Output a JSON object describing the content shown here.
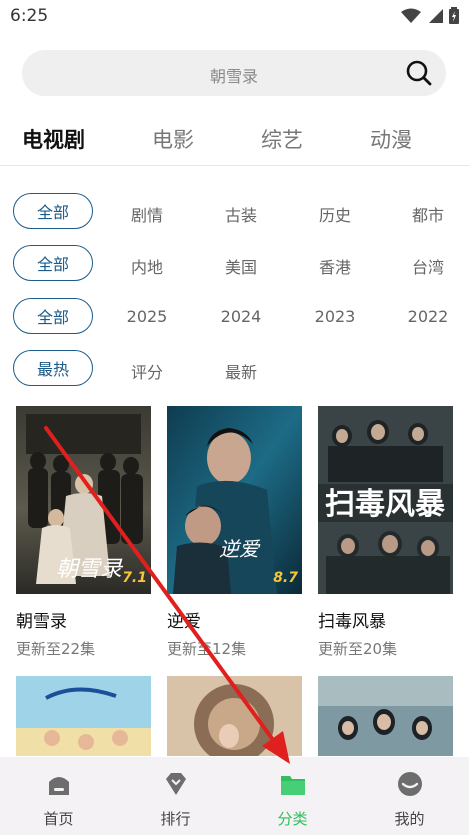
{
  "status_bar": {
    "time": "6:25"
  },
  "search": {
    "placeholder": "朝雪录"
  },
  "category_tabs": [
    {
      "label": "电视剧",
      "active": true
    },
    {
      "label": "电影"
    },
    {
      "label": "综艺"
    },
    {
      "label": "动漫"
    }
  ],
  "filters": {
    "genre": {
      "selected": "全部",
      "options": [
        "剧情",
        "古装",
        "历史",
        "都市"
      ]
    },
    "region": {
      "selected": "全部",
      "options": [
        "内地",
        "美国",
        "香港",
        "台湾"
      ]
    },
    "year": {
      "selected": "全部",
      "options": [
        "2025",
        "2024",
        "2023",
        "2022"
      ]
    },
    "sort": {
      "selected": "最热",
      "options": [
        "评分",
        "最新"
      ]
    }
  },
  "shows": [
    {
      "title": "朝雪录",
      "subtitle": "更新至22集",
      "rating": "7.1",
      "poster_text": "朝雪录"
    },
    {
      "title": "逆爱",
      "subtitle": "更新至12集",
      "rating": "8.7",
      "poster_text": "逆爱"
    },
    {
      "title": "扫毒风暴",
      "subtitle": "更新至20集",
      "rating": "",
      "poster_text": "扫毒风暴"
    }
  ],
  "bottom_nav": [
    {
      "label": "首页",
      "icon": "home-icon"
    },
    {
      "label": "排行",
      "icon": "ranking-icon"
    },
    {
      "label": "分类",
      "icon": "folder-icon",
      "active": true
    },
    {
      "label": "我的",
      "icon": "profile-icon"
    }
  ],
  "colors": {
    "accent": "#1a5b8a",
    "nav_active": "#2fbf5f",
    "annotation_arrow": "#e0201e"
  }
}
